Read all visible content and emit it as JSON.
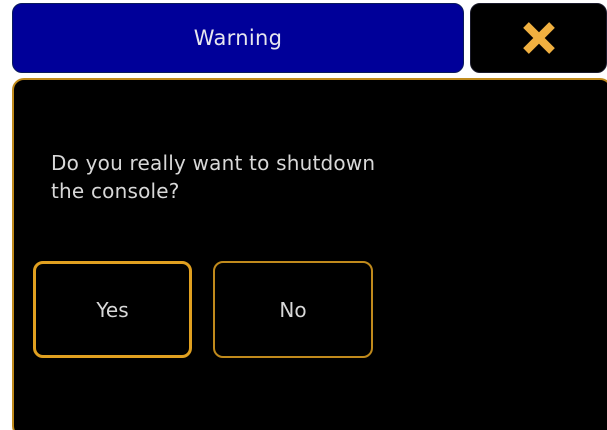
{
  "dialog": {
    "title": "Warning",
    "message": "Do you really want to shutdown\nthe console?",
    "buttons": {
      "yes_label": "Yes",
      "no_label": "No"
    },
    "close_icon": "close-x-icon"
  },
  "colors": {
    "title_bar_bg": "#000099",
    "border_accent": "#c08a1c",
    "selected_border": "#e0a020",
    "close_icon": "#f0b040",
    "text": "#d8d8d8",
    "dialog_bg": "#000000"
  }
}
